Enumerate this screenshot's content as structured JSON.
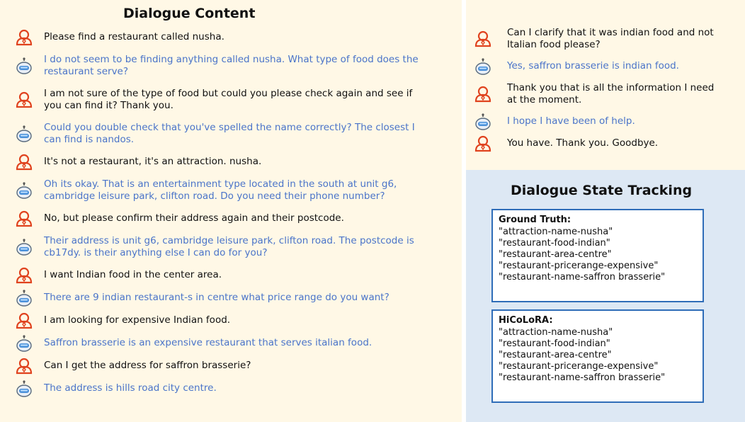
{
  "dialogue": {
    "title": "Dialogue Content",
    "left_turns": [
      {
        "role": "user",
        "lines": [
          "Please find a restaurant called nusha."
        ]
      },
      {
        "role": "bot",
        "lines": [
          "I do not seem to be finding anything called nusha. What type of food does the",
          "restaurant serve?"
        ]
      },
      {
        "role": "user",
        "lines": [
          "I am not sure of the type of food but could you please check again and see if",
          "you can find it? Thank you."
        ]
      },
      {
        "role": "bot",
        "lines": [
          "Could you double check that you've spelled the name correctly? The closest I",
          "can find is nandos."
        ]
      },
      {
        "role": "user",
        "lines": [
          "It's not a restaurant, it's an attraction. nusha."
        ]
      },
      {
        "role": "bot",
        "lines": [
          "Oh its okay. That is an entertainment type located in the south at unit g6,",
          "cambridge leisure park, clifton road. Do you need their phone number?"
        ]
      },
      {
        "role": "user",
        "lines": [
          "No, but please confirm their address again and their postcode."
        ]
      },
      {
        "role": "bot",
        "lines": [
          "Their address is unit g6, cambridge leisure park, clifton road. The postcode is",
          "cb17dy. is their anything else I can do for you?"
        ]
      },
      {
        "role": "user",
        "lines": [
          "I want Indian food in the center area."
        ]
      },
      {
        "role": "bot",
        "lines": [
          "There are 9 indian restaurant-s in centre what price range do you want?"
        ]
      },
      {
        "role": "user",
        "lines": [
          "I am looking for expensive Indian food."
        ]
      },
      {
        "role": "bot",
        "lines": [
          "Saffron brasserie is an expensive restaurant that serves italian food."
        ]
      },
      {
        "role": "user",
        "lines": [
          "Can I get the address for saffron brasserie?"
        ]
      },
      {
        "role": "bot",
        "lines": [
          "The address is hills road city centre."
        ]
      }
    ],
    "right_turns": [
      {
        "role": "user",
        "lines": [
          "Can I clarify that it was indian food and not",
          "Italian food please?"
        ]
      },
      {
        "role": "bot",
        "lines": [
          "Yes, saffron brasserie is indian food."
        ]
      },
      {
        "role": "user",
        "lines": [
          "Thank you that is all the information I need",
          "at the moment."
        ]
      },
      {
        "role": "bot",
        "lines": [
          "I hope I have been of help."
        ]
      },
      {
        "role": "user",
        "lines": [
          "You have. Thank you. Goodbye."
        ]
      }
    ]
  },
  "dst": {
    "title": "Dialogue State Tracking",
    "ground_truth": {
      "label": "Ground Truth:",
      "slots": [
        "\"attraction-name-nusha\"",
        "\"restaurant-food-indian\"",
        "\"restaurant-area-centre\"",
        "\"restaurant-pricerange-expensive\"",
        "\"restaurant-name-saffron  brasserie\""
      ]
    },
    "hicolora": {
      "label": "HiCoLoRA:",
      "slots": [
        "\"attraction-name-nusha\"",
        "\"restaurant-food-indian\"",
        "\"restaurant-area-centre\"",
        "\"restaurant-pricerange-expensive\"",
        "\"restaurant-name-saffron  brasserie\""
      ]
    }
  },
  "colors": {
    "user_icon": "#e0431f",
    "bot_icon": "#4a90d9",
    "bot_text": "#4a74c9",
    "dialogue_bg": "#fff8e6",
    "dst_bg": "#dde8f4",
    "box_border": "#2f6db8"
  },
  "icons": {
    "user": "person-outline-icon",
    "bot": "robot-head-icon"
  }
}
